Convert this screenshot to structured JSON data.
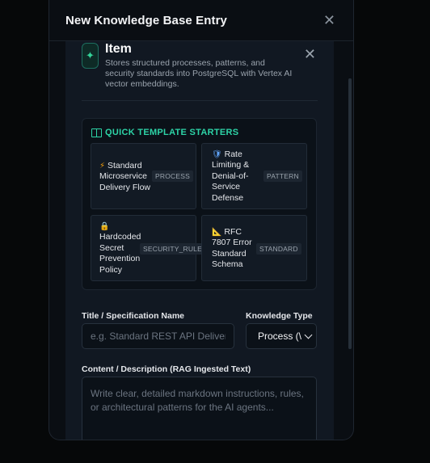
{
  "modal": {
    "title": "New Knowledge Base Entry"
  },
  "item": {
    "title": "Item",
    "description": "Stores structured processes, patterns, and security standards into PostgreSQL with Vertex AI vector embeddings."
  },
  "starters": {
    "title": "QUICK TEMPLATE STARTERS",
    "cards": [
      {
        "icon": "lightning-icon",
        "glyph": "⚡",
        "label": "Standard Microservice Delivery Flow",
        "badge": "PROCESS"
      },
      {
        "icon": "shield-icon",
        "glyph": "🛡",
        "label": "Rate Limiting & Denial-of-Service Defense",
        "badge": "PATTERN"
      },
      {
        "icon": "lock-icon",
        "glyph": "🔒",
        "label": "Hardcoded Secret Prevention Policy",
        "badge": "SECURITY_RULE"
      },
      {
        "icon": "ruler-icon",
        "glyph": "📐",
        "label": "RFC 7807 Error Standard Schema",
        "badge": "STANDARD"
      }
    ]
  },
  "form": {
    "title_label": "Title / Specification Name",
    "title_placeholder": "e.g. Standard REST API Delivery",
    "type_label": "Knowledge Type",
    "type_value": "Process (\\",
    "content_label": "Content / Description (RAG Ingested Text)",
    "content_placeholder": "Write clear, detailed markdown instructions, rules, or architectural patterns for the AI agents..."
  },
  "colors": {
    "accent": "#2dd4a7",
    "background": "#0a0e13",
    "panel": "#111822"
  }
}
